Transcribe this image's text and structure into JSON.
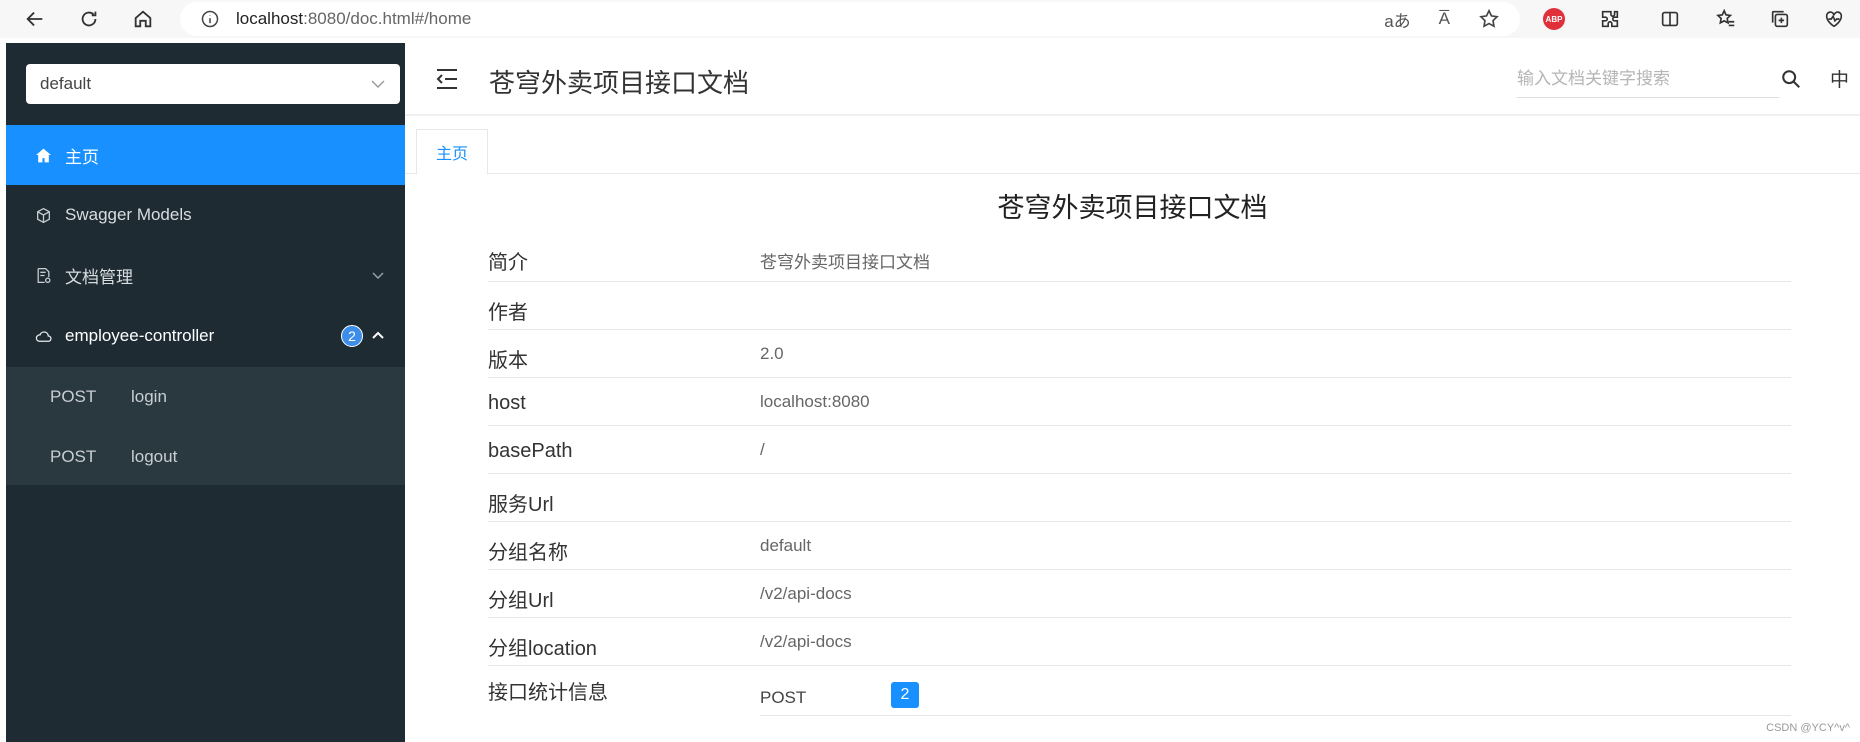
{
  "browser": {
    "url_host": "localhost",
    "url_rest": ":8080/doc.html#/home",
    "read_aloud": "aあ",
    "text_size": "A̅",
    "abp_label": "ABP"
  },
  "sidebar": {
    "group_select": "default",
    "items": [
      {
        "label": "主页",
        "icon": "home-icon"
      },
      {
        "label": "Swagger Models",
        "icon": "cube-icon"
      },
      {
        "label": "文档管理",
        "icon": "document-settings-icon"
      },
      {
        "label": "employee-controller",
        "icon": "cloud-icon",
        "badge": "2"
      }
    ],
    "endpoints": [
      {
        "method": "POST",
        "path": "login"
      },
      {
        "method": "POST",
        "path": "logout"
      }
    ]
  },
  "topbar": {
    "title": "苍穹外卖项目接口文档",
    "search_placeholder": "输入文档关键字搜索",
    "language": "中"
  },
  "tabs": [
    {
      "label": "主页"
    }
  ],
  "doc": {
    "title": "苍穹外卖项目接口文档",
    "rows": [
      {
        "key": "简介",
        "value": "苍穹外卖项目接口文档"
      },
      {
        "key": "作者",
        "value": ""
      },
      {
        "key": "版本",
        "value": "2.0"
      },
      {
        "key": "host",
        "value": "localhost:8080"
      },
      {
        "key": "basePath",
        "value": "/"
      },
      {
        "key": "服务Url",
        "value": ""
      },
      {
        "key": "分组名称",
        "value": "default"
      },
      {
        "key": "分组Url",
        "value": "/v2/api-docs"
      },
      {
        "key": "分组location",
        "value": "/v2/api-docs"
      }
    ],
    "stats": {
      "key": "接口统计信息",
      "method": "POST",
      "count": "2"
    }
  },
  "watermark": "CSDN @YCY^v^",
  "colors": {
    "accent": "#1890ff",
    "sidebar_bg": "#1f2b33",
    "submenu_bg": "#2a3840"
  }
}
